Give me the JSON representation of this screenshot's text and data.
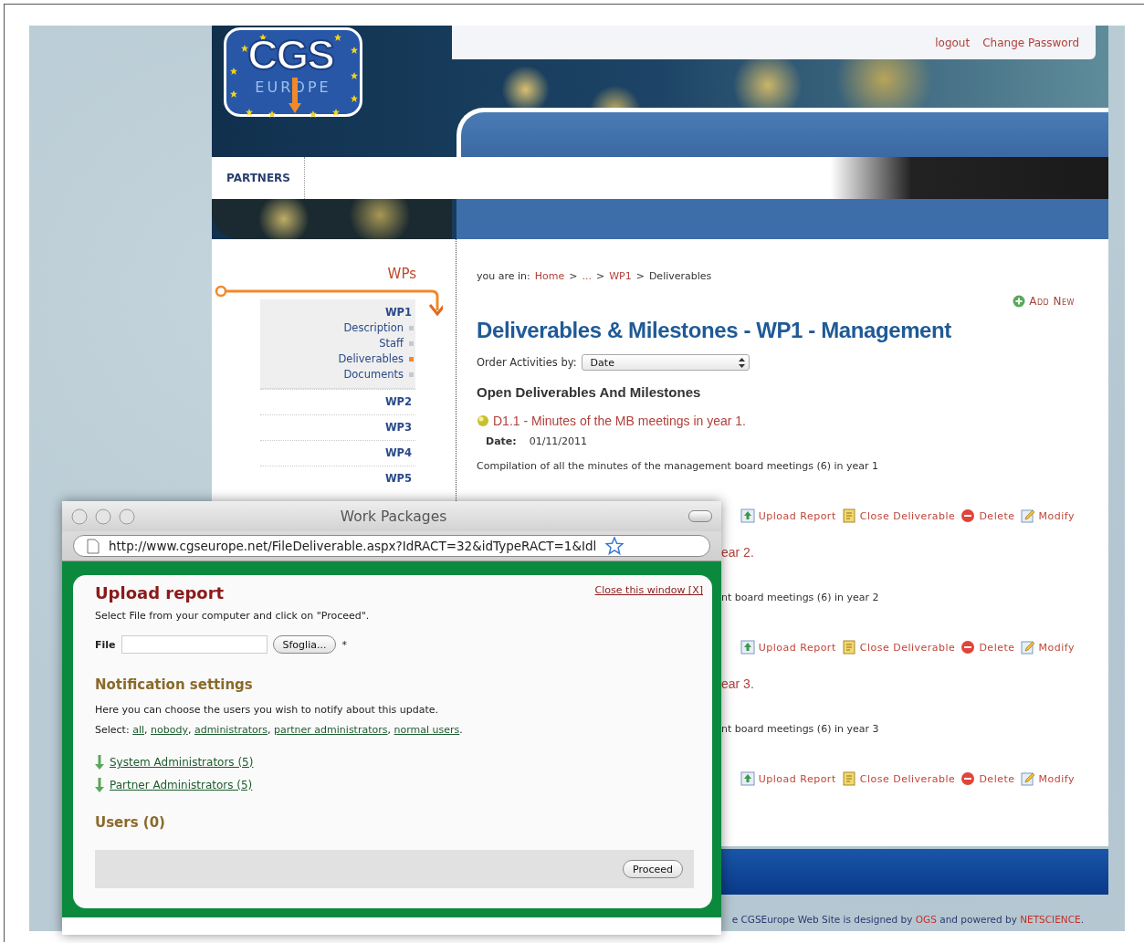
{
  "header": {
    "logo": {
      "top": "CGS",
      "bottom": "EUROPE"
    },
    "top_links": [
      "logout",
      "Change Password"
    ],
    "nav": [
      "PARTNERS"
    ]
  },
  "sidebar": {
    "title": "WPs",
    "items": [
      {
        "label": "WP1",
        "expanded": true,
        "children": [
          {
            "label": "Description",
            "selected": false
          },
          {
            "label": "Staff",
            "selected": false
          },
          {
            "label": "Deliverables",
            "selected": true
          },
          {
            "label": "Documents",
            "selected": false
          }
        ]
      },
      {
        "label": "WP2",
        "expanded": false
      },
      {
        "label": "WP3",
        "expanded": false
      },
      {
        "label": "WP4",
        "expanded": false
      },
      {
        "label": "WP5",
        "expanded": false
      }
    ]
  },
  "main": {
    "breadcrumb": {
      "prefix": "you are in:",
      "separator": ">",
      "items": [
        {
          "label": "Home",
          "kind": "link"
        },
        {
          "label": "...",
          "kind": "link"
        },
        {
          "label": "WP1",
          "kind": "link"
        },
        {
          "label": "Deliverables",
          "kind": "current"
        }
      ]
    },
    "add_new": "Add New",
    "title": "Deliverables & Milestones - WP1 - Management",
    "order": {
      "label": "Order Activities by:",
      "value": "Date"
    },
    "section_title": "Open Deliverables And Milestones",
    "deliverables": [
      {
        "kind": "full",
        "title": "D1.1 - Minutes of the MB meetings in year 1.",
        "date_label": "Date:",
        "date": "01/11/2011",
        "description": "Compilation of all the minutes of the management board meetings (6) in year 1",
        "actions": [
          {
            "label": "Upload Report",
            "kind": "upload"
          },
          {
            "label": "Close Deliverable",
            "kind": "close"
          },
          {
            "label": "Delete",
            "kind": "delete"
          },
          {
            "label": "Modify",
            "kind": "modify"
          }
        ]
      },
      {
        "kind": "partial",
        "title": "ear 2.",
        "description": "nt board meetings (6) in year 2",
        "actions": [
          {
            "label": "Upload Report",
            "kind": "upload"
          },
          {
            "label": "Close Deliverable",
            "kind": "close"
          },
          {
            "label": "Delete",
            "kind": "delete"
          },
          {
            "label": "Modify",
            "kind": "modify"
          }
        ]
      },
      {
        "kind": "partial",
        "title": "ear 3.",
        "description": "nt board meetings (6) in year 3",
        "actions": [
          {
            "label": "Upload Report",
            "kind": "upload"
          },
          {
            "label": "Close Deliverable",
            "kind": "close"
          },
          {
            "label": "Delete",
            "kind": "delete"
          },
          {
            "label": "Modify",
            "kind": "modify"
          }
        ]
      }
    ]
  },
  "footer": {
    "parts": [
      {
        "text": "e CGSEurope Web Site is designed by ",
        "kind": "plain"
      },
      {
        "text": "OGS",
        "kind": "link"
      },
      {
        "text": " and powered by ",
        "kind": "plain"
      },
      {
        "text": "NETSCIENCE",
        "kind": "link"
      },
      {
        "text": ".",
        "kind": "plain"
      }
    ]
  },
  "popup": {
    "window_title": "Work Packages",
    "url": "http://www.cgseurope.net/FileDeliverable.aspx?IdRACT=32&idTypeRACT=1&Idl",
    "title": "Upload report",
    "close_link": "Close this window [X]",
    "instructions": "Select File from your computer and click on \"Proceed\".",
    "file": {
      "label": "File",
      "button": "Sfoglia...",
      "required_mark": "*"
    },
    "notification": {
      "title": "Notification settings",
      "text": "Here you can choose the users you wish to notify about this update.",
      "select_label": "Select:",
      "select_links": [
        "all",
        "nobody",
        "administrators",
        "partner administrators",
        "normal users"
      ],
      "link_separator": ",",
      "end_mark": "."
    },
    "groups": [
      "System Administrators (5)",
      "Partner Administrators (5)"
    ],
    "users_title": "Users (0)",
    "proceed": "Proceed"
  }
}
